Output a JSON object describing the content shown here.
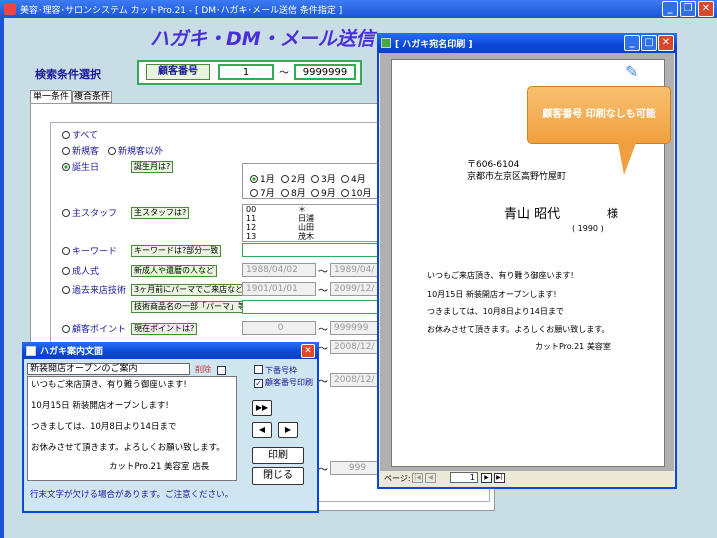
{
  "main_window": {
    "title": "美容･理容･サロンシステム カットPro.21 - [ DM･ハガキ･メール送信 条件指定 ]"
  },
  "banner": {
    "text": "ハガキ・DM・メール送信"
  },
  "search": {
    "label": "検索条件選択",
    "field_label": "顧客番号",
    "from": "1",
    "to": "9999999",
    "tilde": "〜"
  },
  "tabs": [
    "単一条件",
    "複合条件"
  ],
  "conditions": {
    "all": "すべて",
    "new": "新規客",
    "not_new": "新規客以外",
    "birthday": "誕生日",
    "birthday_hint": "誕生月は?",
    "months": [
      "1月",
      "2月",
      "3月",
      "4月",
      "7月",
      "8月",
      "9月",
      "10月"
    ],
    "staff": "主スタッフ",
    "staff_hint": "主スタッフは?",
    "staff_list": [
      {
        "code": "00",
        "name": "＊"
      },
      {
        "code": "11",
        "name": "日浦"
      },
      {
        "code": "12",
        "name": "山田"
      },
      {
        "code": "13",
        "name": "茂木"
      }
    ],
    "keyword": "キーワード",
    "keyword_hint": "キーワードは?部分一致",
    "coming_of_age": "成人式",
    "coming_of_age_hint": "新成人や還暦の人など",
    "coming_from": "1988/04/02",
    "coming_to": "1989/04/",
    "past_visit": "過去来店技術",
    "past_visit_hint": "3ヶ月前にパーマでご来店など",
    "past_from": "1901/01/01",
    "past_to": "2099/12/",
    "product_hint": "技術商品名の一部「パーマ」等",
    "points": "顧客ポイント",
    "points_hint": "現在ポイントは?",
    "points_from": "0",
    "points_to": "999999",
    "date2": "2008/12/",
    "date3": "2008/12/",
    "bottom_value": "999"
  },
  "postcard": {
    "title": "ハガキ案内文面",
    "heading": "新装開店オープンのご案内",
    "delete": "削除",
    "lines": [
      "いつもご来店頂き、有り難う御座います!",
      "10月15日 新装開店オープンします!",
      "つきましては、10月8日より14日まで",
      "お休みさせて頂きます。よろしくお願い致します。",
      "カットPro.21 美容室 店長"
    ],
    "option_fold": "下番号枠",
    "option_print_number": "顧客番号印刷",
    "btn_play": "▶▶",
    "btn_prev": "◀",
    "btn_next": "▶",
    "print": "印刷",
    "close": "閉じる",
    "warning": "行末文字が欠ける場合があります。ご注意ください。"
  },
  "preview": {
    "title": "[ ハガキ宛名印刷 ]",
    "callout": "顧客番号 印刷なしも可能",
    "zip": "〒606-6104",
    "address": "京都市左京区高野竹屋町",
    "name": "青山 昭代",
    "honorific": "様",
    "number": "( 1990 )",
    "lines": [
      "いつもご来店頂き、有り難う御座います!",
      "10月15日 新装開店オープンします!",
      "つきましては、10月8日より14日まで",
      "お休みさせて頂きます。よろしくお願い致します。",
      "カットPro.21 美容室"
    ],
    "page_label": "ページ:",
    "page": "1"
  }
}
